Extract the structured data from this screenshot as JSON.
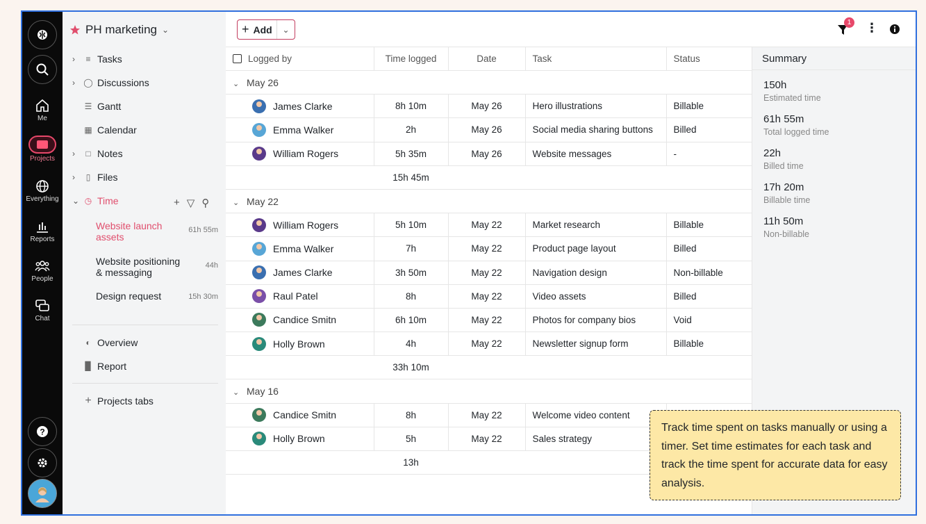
{
  "rail": {
    "me_label": "Me",
    "projects_label": "Projects",
    "everything_label": "Everything",
    "reports_label": "Reports",
    "people_label": "People",
    "chat_label": "Chat"
  },
  "sidebar": {
    "project_title": "PH marketing",
    "items": {
      "tasks": "Tasks",
      "discussions": "Discussions",
      "gantt": "Gantt",
      "calendar": "Calendar",
      "notes": "Notes",
      "files": "Files",
      "time": "Time",
      "overview": "Overview",
      "report": "Report",
      "projects_tabs": "Projects tabs"
    },
    "time_subitems": [
      {
        "label": "Website launch assets",
        "hours": "61h 55m"
      },
      {
        "label": "Website positioning & messaging",
        "hours": "44h"
      },
      {
        "label": "Design request",
        "hours": "15h 30m"
      }
    ]
  },
  "toolbar": {
    "add_label": "Add",
    "filter_badge": "1"
  },
  "table": {
    "headers": {
      "logged_by": "Logged by",
      "time_logged": "Time logged",
      "date": "Date",
      "task": "Task",
      "status": "Status"
    },
    "groups": [
      {
        "label": "May 26",
        "total": "15h 45m",
        "rows": [
          {
            "name": "James Clarke",
            "time": "8h 10m",
            "date": "May 26",
            "task": "Hero illustrations",
            "status": "Billable"
          },
          {
            "name": "Emma Walker",
            "time": "2h",
            "date": "May 26",
            "task": "Social media sharing buttons",
            "status": "Billed"
          },
          {
            "name": "William Rogers",
            "time": "5h 35m",
            "date": "May 26",
            "task": "Website messages",
            "status": "-"
          }
        ]
      },
      {
        "label": "May 22",
        "total": "33h 10m",
        "rows": [
          {
            "name": "William Rogers",
            "time": "5h 10m",
            "date": "May 22",
            "task": "Market research",
            "status": "Billable"
          },
          {
            "name": "Emma Walker",
            "time": "7h",
            "date": "May 22",
            "task": "Product page layout",
            "status": "Billed"
          },
          {
            "name": "James Clarke",
            "time": "3h 50m",
            "date": "May 22",
            "task": "Navigation design",
            "status": "Non-billable"
          },
          {
            "name": "Raul Patel",
            "time": "8h",
            "date": "May 22",
            "task": "Video assets",
            "status": "Billed"
          },
          {
            "name": "Candice Smitn",
            "time": "6h 10m",
            "date": "May 22",
            "task": "Photos for company bios",
            "status": "Void"
          },
          {
            "name": "Holly Brown",
            "time": "4h",
            "date": "May 22",
            "task": "Newsletter signup form",
            "status": "Billable"
          }
        ]
      },
      {
        "label": "May 16",
        "total": "13h",
        "rows": [
          {
            "name": "Candice Smitn",
            "time": "8h",
            "date": "May 22",
            "task": "Welcome video content",
            "status": ""
          },
          {
            "name": "Holly Brown",
            "time": "5h",
            "date": "May 22",
            "task": "Sales strategy",
            "status": ""
          }
        ]
      }
    ]
  },
  "summary": {
    "title": "Summary",
    "items": [
      {
        "value": "150h",
        "label": "Estimated time"
      },
      {
        "value": "61h 55m",
        "label": "Total logged time"
      },
      {
        "value": "22h",
        "label": "Billed time"
      },
      {
        "value": "17h 20m",
        "label": "Billable time"
      },
      {
        "value": "11h 50m",
        "label": "Non-billable"
      }
    ]
  },
  "callout": {
    "text": "Track time spent on tasks manually or using a timer. Set time estimates for each task and track the time spent for accurate data for easy analysis."
  },
  "colors": {
    "accent": "#e04e6d",
    "rail_bg": "#0a0a0a",
    "callout_bg": "#fde8a6",
    "frame": "#2f6fde"
  }
}
